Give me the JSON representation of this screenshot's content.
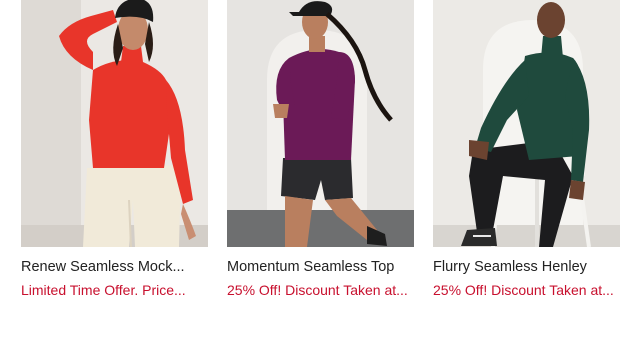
{
  "products": [
    {
      "name": "Renew Seamless Mock...",
      "promo": "Limited Time Offer. Price...",
      "image_alt": "Model wearing red mock neck top and cream pants",
      "colors": {
        "top": "#e8352a",
        "bottom": "#efe6d8",
        "bg": "#e9e6e2"
      }
    },
    {
      "name": "Momentum Seamless Top",
      "promo": "25% Off! Discount Taken at...",
      "image_alt": "Model running in purple top and black shorts",
      "colors": {
        "top": "#6b1a57",
        "bottom": "#2b2b2e",
        "bg": "#e4e2df"
      }
    },
    {
      "name": "Flurry Seamless Henley",
      "promo": "25% Off! Discount Taken at...",
      "image_alt": "Model sitting on stool in dark green henley and black leggings",
      "colors": {
        "top": "#1f4a3d",
        "bottom": "#1c1c1e",
        "bg": "#ecebe8"
      }
    }
  ],
  "promo_color": "#c8102e"
}
